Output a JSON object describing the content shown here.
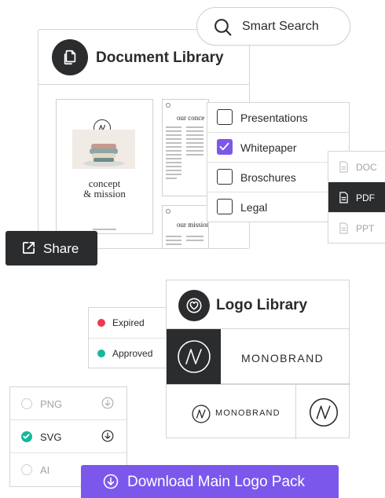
{
  "search": {
    "label": "Smart Search",
    "icon": "search-icon"
  },
  "document_library": {
    "title": "Document Library",
    "icon": "documents-icon",
    "cover": {
      "line1": "concept",
      "line2": "& mission"
    },
    "page2_heading": "our conce",
    "page3_heading": "our mission"
  },
  "categories": {
    "items": [
      {
        "label": "Presentations",
        "checked": false
      },
      {
        "label": "Whitepaper",
        "checked": true
      },
      {
        "label": "Broschures",
        "checked": false
      },
      {
        "label": "Legal",
        "checked": false
      }
    ]
  },
  "file_types": {
    "items": [
      {
        "label": "DOC",
        "selected": false
      },
      {
        "label": "PDF",
        "selected": true
      },
      {
        "label": "PPT",
        "selected": false
      }
    ]
  },
  "share": {
    "label": "Share",
    "icon": "external-link-icon"
  },
  "status": {
    "items": [
      {
        "label": "Expired",
        "color": "#f0384f"
      },
      {
        "label": "Approved",
        "color": "#12b99c"
      }
    ]
  },
  "logo_library": {
    "title": "Logo Library",
    "icon": "heart-icon",
    "brand_name": "MONOBRAND",
    "brand_name_small": "MONOBRAND"
  },
  "formats": {
    "items": [
      {
        "label": "PNG",
        "selected": false
      },
      {
        "label": "SVG",
        "selected": true
      },
      {
        "label": "AI",
        "selected": false
      }
    ]
  },
  "download": {
    "label": "Download Main Logo Pack",
    "icon": "download-icon"
  },
  "colors": {
    "accent": "#7b57ec",
    "dark": "#2b2c2e",
    "approved": "#12b99c",
    "expired": "#f0384f"
  }
}
